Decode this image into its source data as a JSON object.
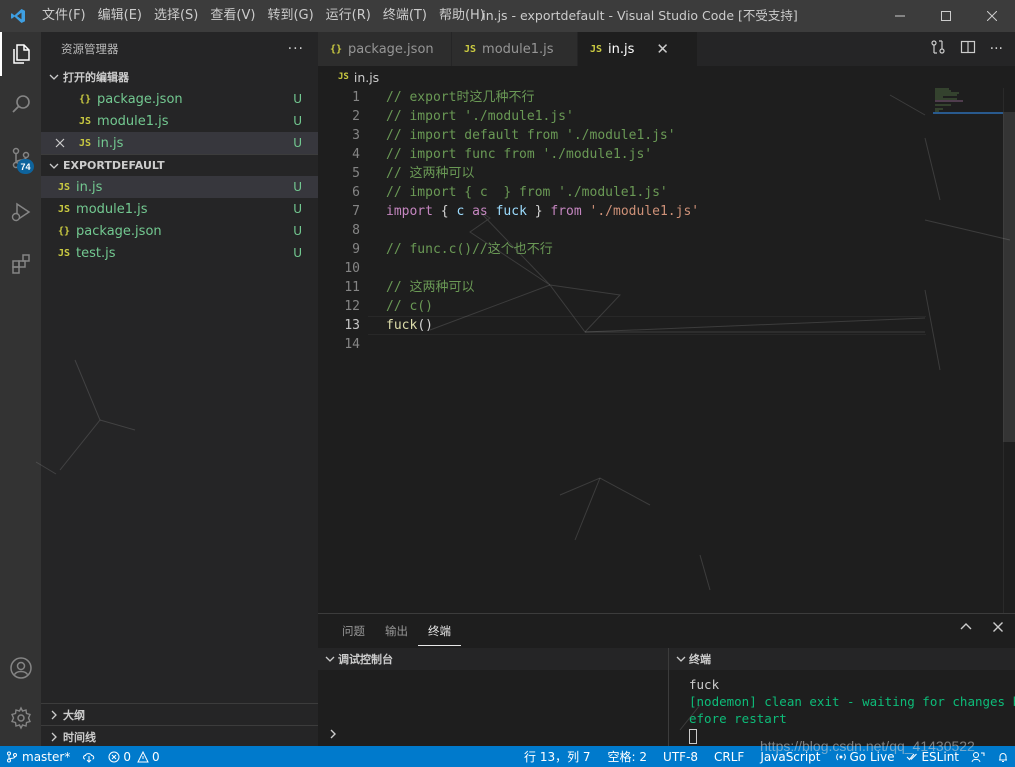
{
  "titlebar": {
    "menu": [
      "文件(F)",
      "编辑(E)",
      "选择(S)",
      "查看(V)",
      "转到(G)",
      "运行(R)",
      "终端(T)",
      "帮助(H)"
    ],
    "title": "in.js - exportdefault - Visual Studio Code [不受支持]"
  },
  "activity_bar": {
    "icons": [
      "explorer-icon",
      "search-icon",
      "source-control-icon",
      "run-debug-icon",
      "extensions-icon",
      "account-icon",
      "gear-icon"
    ],
    "scm_badge": "74",
    "accent": "#0e639c"
  },
  "sidebar": {
    "title": "资源管理器",
    "more": "···",
    "open_editors": {
      "label": "打开的编辑器",
      "items": [
        {
          "icon": "{}",
          "name": "package.json",
          "status": "U"
        },
        {
          "icon": "JS",
          "name": "module1.js",
          "status": "U"
        },
        {
          "icon": "JS",
          "name": "in.js",
          "status": "U"
        }
      ]
    },
    "folder": {
      "label": "EXPORTDEFAULT",
      "items": [
        {
          "icon": "JS",
          "name": "in.js",
          "status": "U"
        },
        {
          "icon": "JS",
          "name": "module1.js",
          "status": "U"
        },
        {
          "icon": "{}",
          "name": "package.json",
          "status": "U"
        },
        {
          "icon": "JS",
          "name": "test.js",
          "status": "U"
        }
      ]
    },
    "outline": "大纲",
    "timeline": "时间线"
  },
  "tabs": [
    {
      "icon": "{}",
      "name": "package.json"
    },
    {
      "icon": "JS",
      "name": "module1.js"
    },
    {
      "icon": "JS",
      "name": "in.js",
      "close": "✕"
    }
  ],
  "breadcrumb": {
    "icon": "JS",
    "file": "in.js"
  },
  "editor": {
    "current_line": 13,
    "lines": [
      {
        "n": "1",
        "t": [
          {
            "c": "cmt",
            "s": "// export时这几种不行"
          }
        ]
      },
      {
        "n": "2",
        "t": [
          {
            "c": "cmt",
            "s": "// import './module1.js'"
          }
        ]
      },
      {
        "n": "3",
        "t": [
          {
            "c": "cmt",
            "s": "// import default from './module1.js'"
          }
        ]
      },
      {
        "n": "4",
        "t": [
          {
            "c": "cmt",
            "s": "// import func from './module1.js'"
          }
        ]
      },
      {
        "n": "5",
        "t": [
          {
            "c": "cmt",
            "s": "// 这两种可以"
          }
        ]
      },
      {
        "n": "6",
        "t": [
          {
            "c": "cmt",
            "s": "// import { c  } from './module1.js'"
          }
        ]
      },
      {
        "n": "7",
        "t": [
          {
            "c": "kw",
            "s": "import"
          },
          {
            "c": "pl",
            "s": " { "
          },
          {
            "c": "var",
            "s": "c"
          },
          {
            "c": "pl",
            "s": " "
          },
          {
            "c": "kw",
            "s": "as"
          },
          {
            "c": "pl",
            "s": " "
          },
          {
            "c": "var",
            "s": "fuck"
          },
          {
            "c": "pl",
            "s": " } "
          },
          {
            "c": "kw",
            "s": "from"
          },
          {
            "c": "pl",
            "s": " "
          },
          {
            "c": "str",
            "s": "'./module1.js'"
          }
        ]
      },
      {
        "n": "8",
        "t": []
      },
      {
        "n": "9",
        "t": [
          {
            "c": "cmt",
            "s": "// func.c()//这个也不行"
          }
        ]
      },
      {
        "n": "10",
        "t": []
      },
      {
        "n": "11",
        "t": [
          {
            "c": "cmt",
            "s": "// 这两种可以"
          }
        ]
      },
      {
        "n": "12",
        "t": [
          {
            "c": "cmt",
            "s": "// c()"
          }
        ]
      },
      {
        "n": "13",
        "t": [
          {
            "c": "fn",
            "s": "fuck"
          },
          {
            "c": "pl",
            "s": "()"
          }
        ]
      },
      {
        "n": "14",
        "t": []
      }
    ]
  },
  "panel": {
    "tabs": [
      "问题",
      "输出",
      "终端"
    ],
    "active_tab": "终端",
    "debug_console": "调试控制台",
    "terminal_label": "终端",
    "terminal_lines": [
      {
        "c": "term-white",
        "s": "fuck"
      },
      {
        "c": "term-green",
        "s": "[nodemon] clean exit - waiting for changes b"
      },
      {
        "c": "term-green",
        "s": "efore restart"
      }
    ]
  },
  "statusbar": {
    "branch": "master*",
    "errors": "0",
    "warnings": "0",
    "position": "行 13，列 7",
    "spaces": "空格: 2",
    "encoding": "UTF-8",
    "eol": "CRLF",
    "language": "JavaScript",
    "golive": "Go Live",
    "eslint": "ESLint",
    "color": "#007acc"
  },
  "watermark": "https://blog.csdn.net/qq_41430522"
}
